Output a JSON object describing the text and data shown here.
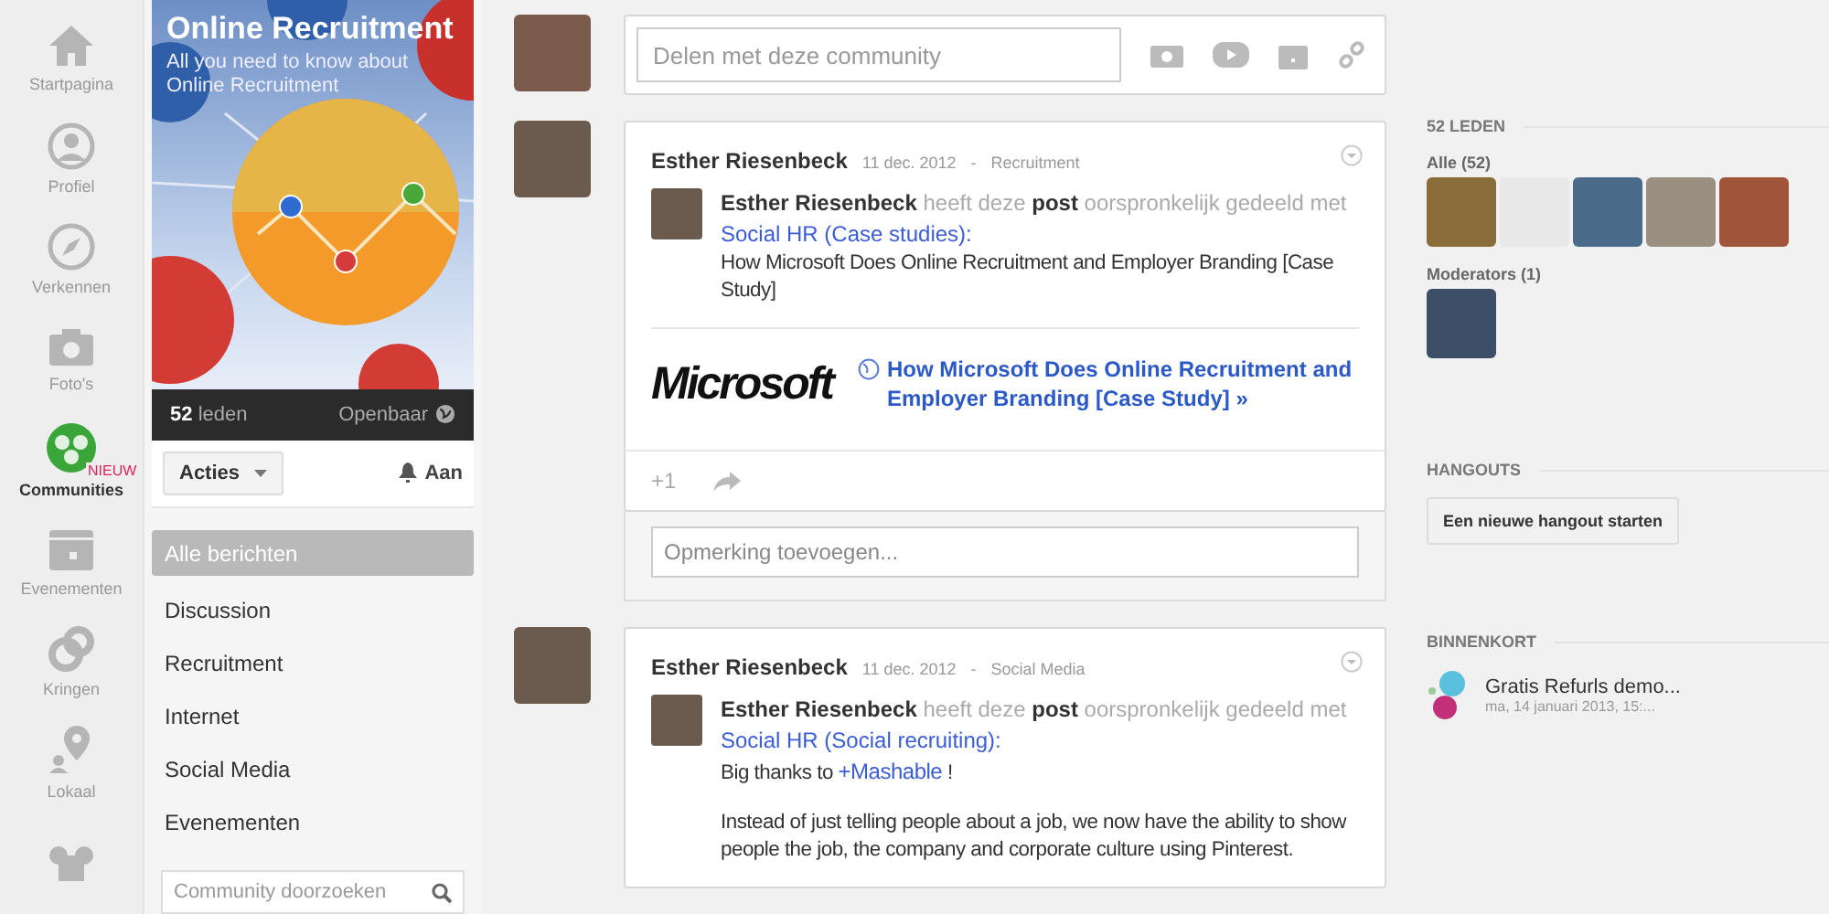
{
  "nav": [
    {
      "label": "Startpagina",
      "selected": false
    },
    {
      "label": "Profiel",
      "selected": false
    },
    {
      "label": "Verkennen",
      "selected": false
    },
    {
      "label": "Foto's",
      "selected": false
    },
    {
      "label": "Communities",
      "selected": true,
      "badge": "NIEUW"
    },
    {
      "label": "Evenementen",
      "selected": false
    },
    {
      "label": "Kringen",
      "selected": false
    },
    {
      "label": "Lokaal",
      "selected": false
    },
    {
      "selected": false
    }
  ],
  "community": {
    "title": "Online Recruitment",
    "subtitle": "All you need to know about Online Recruitment",
    "member_count": "52",
    "members_label": "leden",
    "visibility": "Openbaar",
    "actions_button": "Acties",
    "notifications": "Aan",
    "categories": [
      {
        "label": "Alle berichten",
        "selected": true
      },
      {
        "label": "Discussion",
        "selected": false
      },
      {
        "label": "Recruitment",
        "selected": false
      },
      {
        "label": "Internet",
        "selected": false
      },
      {
        "label": "Social Media",
        "selected": false
      },
      {
        "label": "Evenementen",
        "selected": false
      }
    ],
    "search": {
      "placeholder": "Community doorzoeken"
    }
  },
  "share": {
    "placeholder": "Delen met deze community"
  },
  "posts": [
    {
      "author": "Esther Riesenbeck",
      "date": "11 dec. 2012",
      "separator": "-",
      "category": "Recruitment",
      "shared_line": "**Esther Riesenbeck** heeft deze **post** oorspronkelijk gedeeld met",
      "shared_with": "Social HR (Case studies):",
      "body": [
        {
          "kind": "text",
          "text": "How Microsoft Does Online Recruitment and Employer Branding [Case Study]"
        }
      ],
      "link_preview": {
        "logo": "Microsoft",
        "title": "How Microsoft Does Online Recruitment and Employer Branding [Case Study] »"
      },
      "plus_one": "+1",
      "comment": {
        "placeholder": "Opmerking toevoegen..."
      }
    },
    {
      "author": "Esther Riesenbeck",
      "date": "11 dec. 2012",
      "separator": "-",
      "category": "Social Media",
      "shared_line": "**Esther Riesenbeck** heeft deze **post** oorspronkelijk gedeeld met",
      "shared_with": "Social HR (Social recruiting):",
      "body": [
        {
          "kind": "mention",
          "before": "Big thanks to",
          "mention": "+Mashable",
          "after": "!"
        },
        {
          "kind": "text",
          "text": "Instead of just telling people about a job, we now have the ability to show people the job, the company and corporate culture using Pinterest."
        }
      ]
    }
  ],
  "sidebar": {
    "members_heading": "52 LEDEN",
    "all_label": "Alle (52)",
    "moderators_label": "Moderators (1)",
    "hangouts_heading": "HANGOUTS",
    "hangout_button": "Een nieuwe hangout starten",
    "upcoming_heading": "BINNENKORT",
    "events": [
      {
        "title": "Gratis Refurls demo...",
        "time": "ma, 14 januari 2013, 15:..."
      }
    ]
  }
}
